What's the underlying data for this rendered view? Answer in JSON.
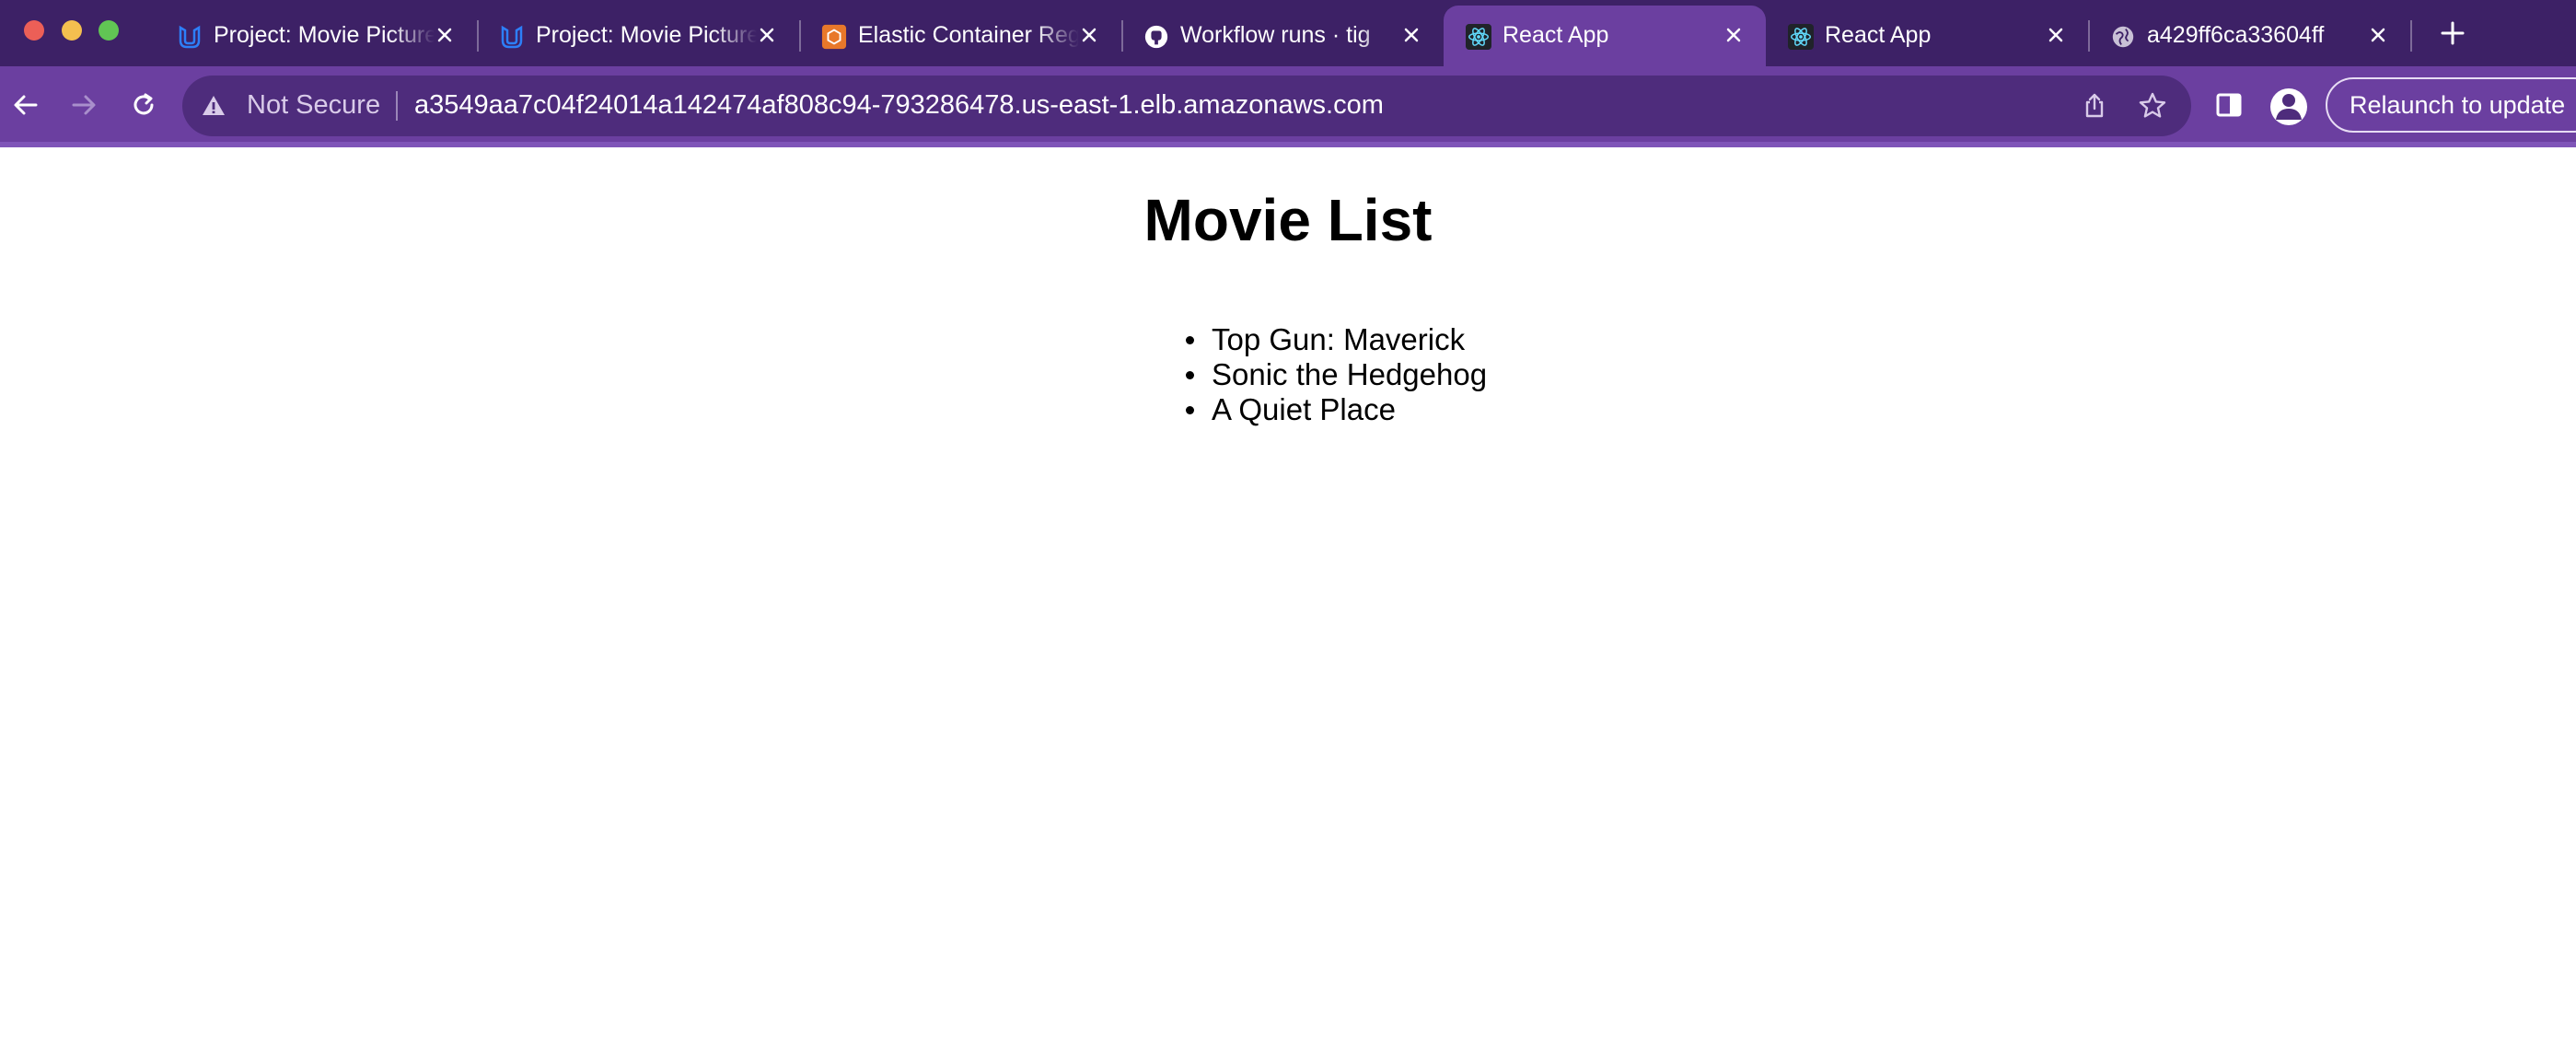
{
  "browser": {
    "tabs": [
      {
        "title": "Project: Movie Picture Pipeline",
        "favicon": "udacity-icon",
        "active": false
      },
      {
        "title": "Project: Movie Picture Pipeline",
        "favicon": "udacity-icon",
        "active": false
      },
      {
        "title": "Elastic Container Registry",
        "favicon": "aws-ecr-icon",
        "active": false
      },
      {
        "title": "Workflow runs · tig",
        "favicon": "github-icon",
        "active": false
      },
      {
        "title": "React App",
        "favicon": "react-icon",
        "active": true
      },
      {
        "title": "React App",
        "favicon": "react-icon",
        "active": false
      },
      {
        "title": "a429ff6ca33604ff",
        "favicon": "globe-icon",
        "active": false
      }
    ],
    "address_bar": {
      "security_label": "Not Secure",
      "url": "a3549aa7c04f24014a142474af808c94-793286478.us-east-1.elb.amazonaws.com"
    },
    "relaunch_label": "Relaunch to update",
    "colors": {
      "tabstrip": "#3d2166",
      "toolbar": "#6b3fa0",
      "omnibox": "#4e2c7c"
    }
  },
  "page": {
    "title": "Movie List",
    "movies": [
      "Top Gun: Maverick",
      "Sonic the Hedgehog",
      "A Quiet Place"
    ]
  }
}
